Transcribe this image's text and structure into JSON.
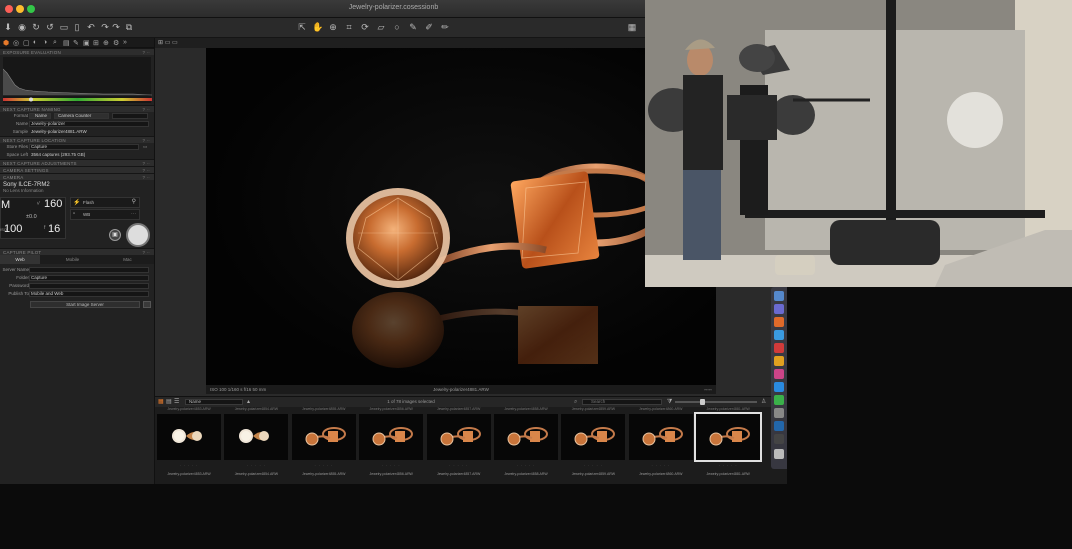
{
  "window": {
    "title": "Jewelry-polarizer.cosessionb",
    "traffic_colors": [
      "#fc5f57",
      "#fdbc2e",
      "#33c748"
    ]
  },
  "left_panel": {
    "sections": {
      "exposure": "EXPOSURE EVALUATION",
      "naming": "NEXT CAPTURE NAMING",
      "location": "NEXT CAPTURE LOCATION",
      "adjustments": "NEXT CAPTURE ADJUSTMENTS",
      "camera_settings": "CAMERA SETTINGS",
      "camera": "CAMERA",
      "pilot": "CAPTURE PILOT"
    },
    "naming": {
      "format_label": "Format",
      "format_opt1": "Name",
      "format_opt2": "Camera Counter",
      "name_label": "Name",
      "name_value": "Jewelry-polarizer",
      "sample_label": "Sample",
      "sample_value": "Jewelry-polarizer4881.ARW"
    },
    "location": {
      "store_label": "Store Files",
      "store_value": "Capture",
      "space_label": "Space Left",
      "space_value": "3564 captures (293.75 GB)"
    },
    "camera": {
      "model": "Sony ILCE-7RM2",
      "lens": "No Lens Information",
      "mode": "M",
      "shutter_prefix": "¹⁄",
      "shutter": "160",
      "ev": "±0.0",
      "iso_prefix": "ISO",
      "iso": "100",
      "fstop_prefix": "f",
      "fstop": "16",
      "flash": "Flash",
      "wb": "WB",
      "flash_color": "#5a8edc"
    },
    "pilot": {
      "tab_web": "Web",
      "tab_mobile": "Mobile",
      "tab_mac": "Mac",
      "server_label": "Server Name",
      "folder_label": "Folder",
      "folder_value": "Capture",
      "password_label": "Password",
      "publish_label": "Publish To",
      "publish_value": "Mobile and Web",
      "start_button": "Start Image Server"
    }
  },
  "viewer": {
    "meta": "ISO 100   1/160 s   f/16   50 mm",
    "filename": "Jewelry-polarizer4881.ARW"
  },
  "browser": {
    "sort_value": "Name",
    "selection_count": "1 of 78 images selected",
    "search_placeholder": "Search",
    "rating_placeholder": "· · · · ·",
    "thumb_captions": [
      "Jewelry-polarizer4853.ARW",
      "Jewelry-polarizer4854.ARW",
      "Jewelry-polarizer4855.ARW",
      "Jewelry-polarizer4856.ARW",
      "Jewelry-polarizer4857.ARW",
      "Jewelry-polarizer4858.ARW",
      "Jewelry-polarizer4859.ARW",
      "Jewelry-polarizer4860.ARW",
      "Jewelry-polarizer4881.ARW"
    ]
  },
  "colors": {
    "accent": "#e87a2a",
    "gold": "#c47a4a",
    "stone": "#d9864a"
  }
}
